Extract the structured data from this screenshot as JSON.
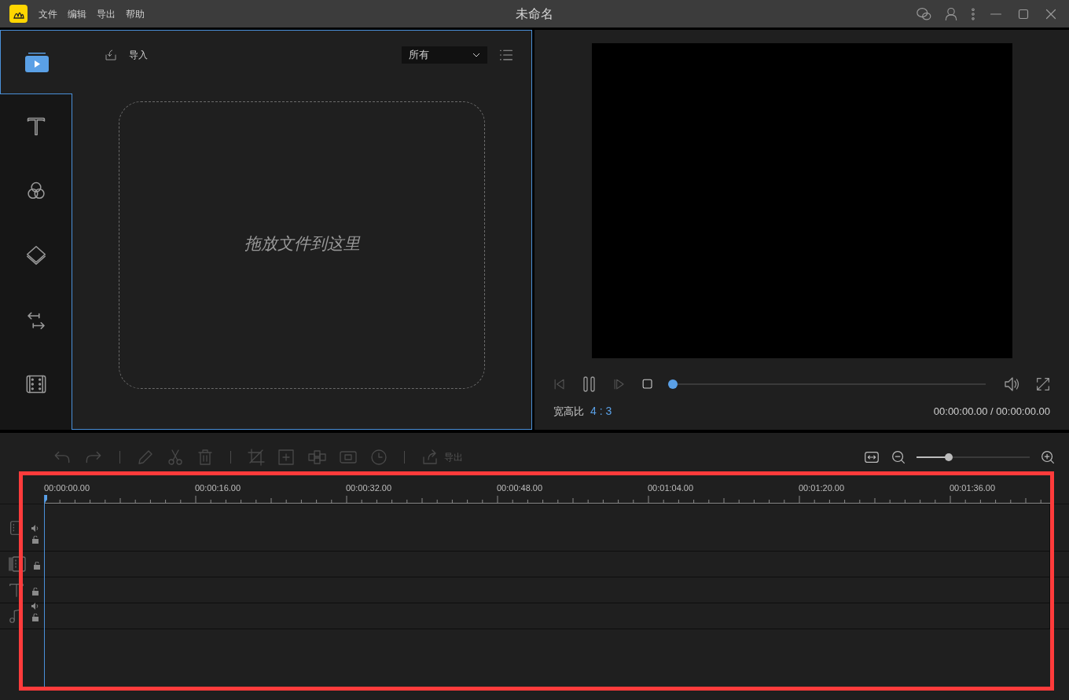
{
  "window": {
    "title": "未命名",
    "menu": [
      "文件",
      "编辑",
      "导出",
      "帮助"
    ]
  },
  "media_panel": {
    "tabs": [
      {
        "kind": "media",
        "selected": true
      },
      {
        "kind": "text",
        "selected": false
      },
      {
        "kind": "filter",
        "selected": false
      },
      {
        "kind": "overlay",
        "selected": false
      },
      {
        "kind": "transition",
        "selected": false
      },
      {
        "kind": "element",
        "selected": false
      }
    ],
    "import_label": "导入",
    "filter_value": "所有",
    "drop_hint": "拖放文件到这里"
  },
  "preview": {
    "progress": {
      "level": 0
    },
    "aspect_label": "宽高比",
    "aspect_value": "4 : 3",
    "time": "00:00:00.00 / 00:00:00.00"
  },
  "toolbar": {
    "export_label": "导出",
    "zoom": {
      "level": 0.27
    }
  },
  "timeline": {
    "ruler": [
      "00:00:00.00",
      "00:00:16.00",
      "00:00:32.00",
      "00:00:48.00",
      "00:01:04.00",
      "00:01:20.00",
      "00:01:36.00"
    ],
    "tracks": [
      {
        "kind": "video"
      },
      {
        "kind": "pip"
      },
      {
        "kind": "text"
      },
      {
        "kind": "audio"
      }
    ]
  },
  "highlight_box": {
    "visible": true
  }
}
